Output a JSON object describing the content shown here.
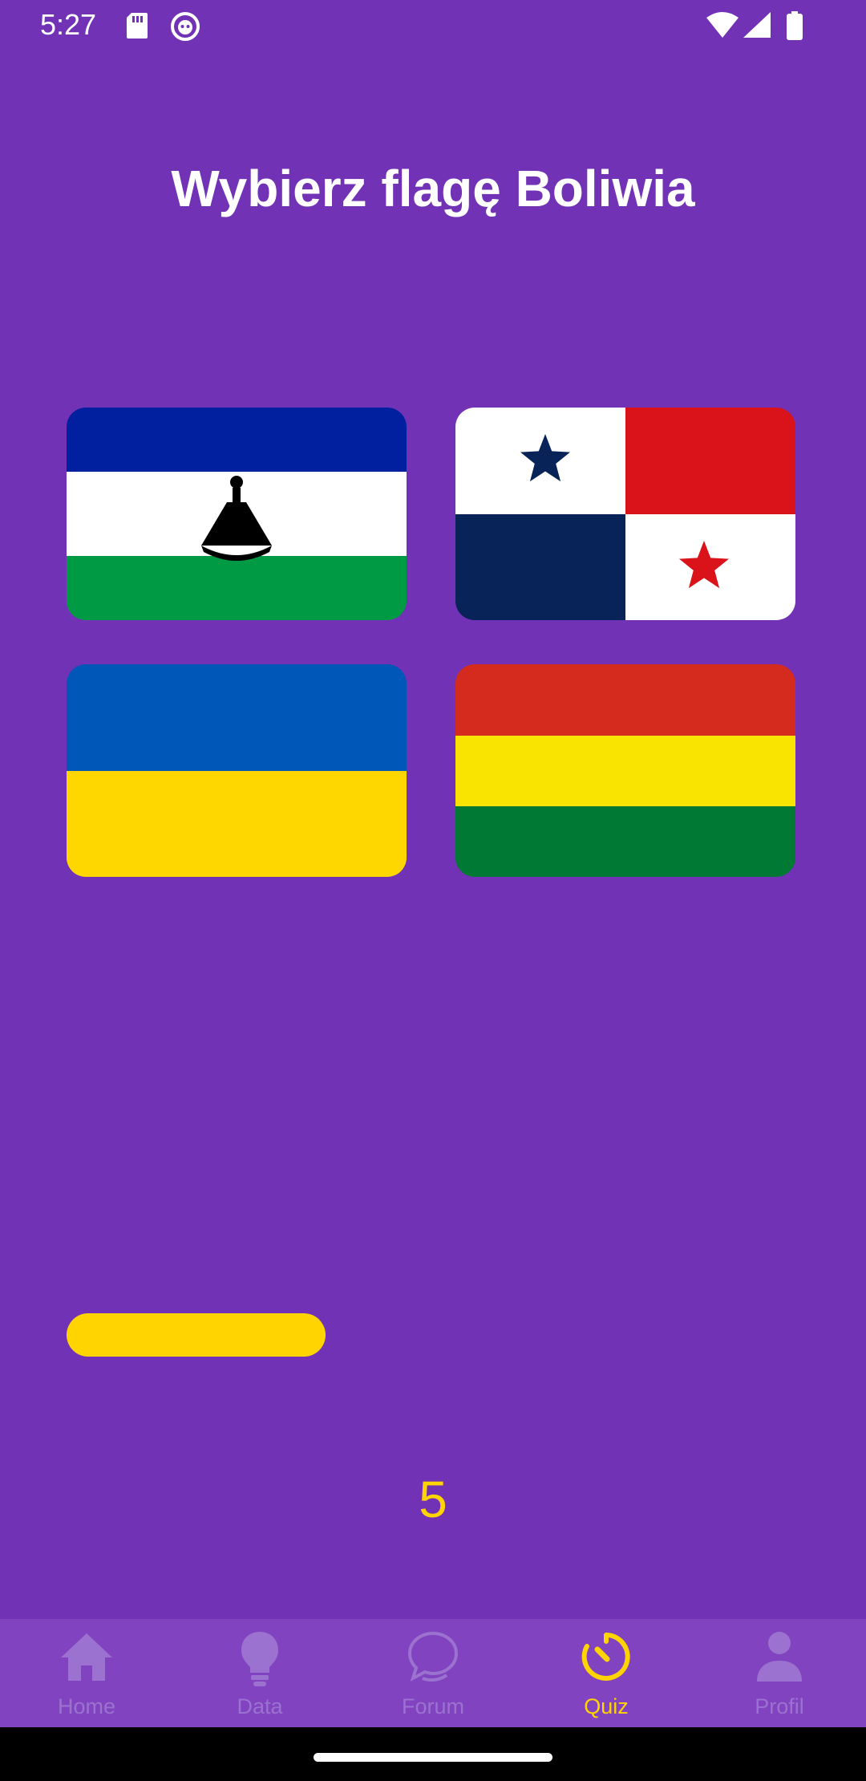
{
  "status_bar": {
    "time": "5:27"
  },
  "quiz": {
    "title": "Wybierz flagę Boliwia",
    "options": [
      {
        "country": "Lesotho",
        "colors": {
          "blue": "#00209f",
          "white": "#ffffff",
          "green": "#009a44"
        }
      },
      {
        "country": "Panama",
        "colors": {
          "blue": "#072357",
          "red": "#da121a",
          "white": "#ffffff"
        }
      },
      {
        "country": "Ukraine",
        "colors": {
          "blue": "#0057b7",
          "yellow": "#ffd700"
        }
      },
      {
        "country": "Bolivia",
        "colors": {
          "red": "#d52b1e",
          "yellow": "#f9e300",
          "green": "#007934"
        }
      }
    ],
    "timer_progress": 0.353,
    "counter": "5"
  },
  "nav": {
    "items": [
      {
        "label": "Home",
        "icon": "home-icon",
        "active": false
      },
      {
        "label": "Data",
        "icon": "lightbulb-icon",
        "active": false
      },
      {
        "label": "Forum",
        "icon": "chat-bubble-icon",
        "active": false
      },
      {
        "label": "Quiz",
        "icon": "timer-icon",
        "active": true
      },
      {
        "label": "Profil",
        "icon": "person-icon",
        "active": false
      }
    ]
  },
  "colors": {
    "background": "#7132b6",
    "nav_background": "#8143bf",
    "accent": "#ffd400",
    "nav_inactive": "#9b72d0"
  }
}
